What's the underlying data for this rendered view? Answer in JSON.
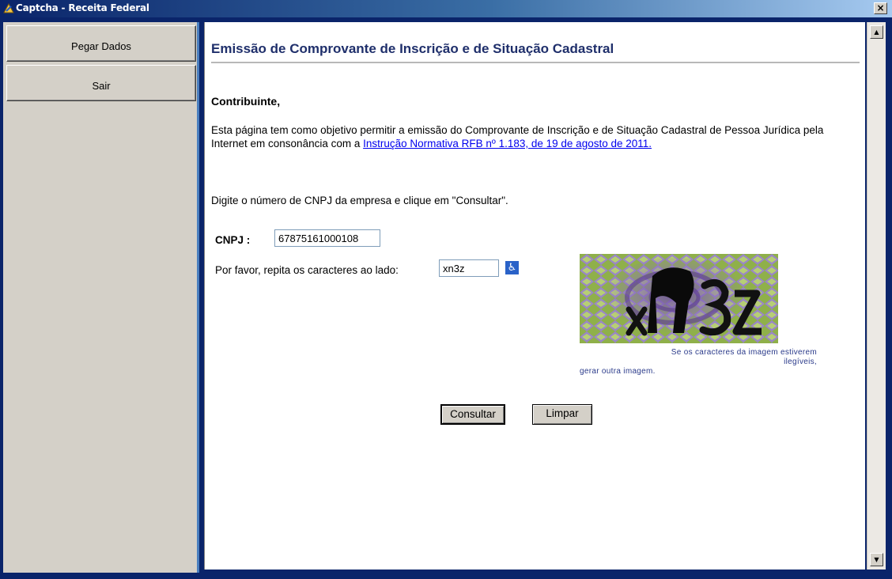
{
  "window": {
    "title": "Captcha - Receita Federal",
    "close_glyph": "×"
  },
  "sidebar": {
    "items": [
      {
        "label": "Pegar Dados"
      },
      {
        "label": "Sair"
      }
    ]
  },
  "main": {
    "heading": "Emissão de Comprovante de Inscrição e de Situação Cadastral",
    "greeting": "Contribuinte,",
    "intro_text": "Esta página tem como objetivo permitir a emissão do Comprovante de Inscrição e de Situação Cadastral de Pessoa Jurídica pela Internet em consonância com a ",
    "intro_link": "Instrução Normativa RFB nº 1.183, de 19 de agosto de 2011.",
    "instruction": "Digite o número de CNPJ da empresa e clique em \"Consultar\".",
    "cnpj_label": "CNPJ :",
    "cnpj_value": "67875161000108",
    "captcha_label": "Por favor, repita os caracteres ao lado:",
    "captcha_value": "xn3z",
    "accessibility_icon": "wheelchair-icon",
    "captcha_caption_line1": "Se os caracteres da imagem estiverem",
    "captcha_caption_line2": "ilegíveis,",
    "captcha_regenerate_link": "gerar outra imagem.",
    "buttons": {
      "consultar": "Consultar",
      "limpar": "Limpar"
    }
  },
  "scrollbar": {
    "up_glyph": "▲",
    "down_glyph": "▼"
  },
  "colors": {
    "heading": "#1f2f6b",
    "link": "#0000ee",
    "titlebar_start": "#0a246a",
    "panel": "#d4d0c8"
  }
}
